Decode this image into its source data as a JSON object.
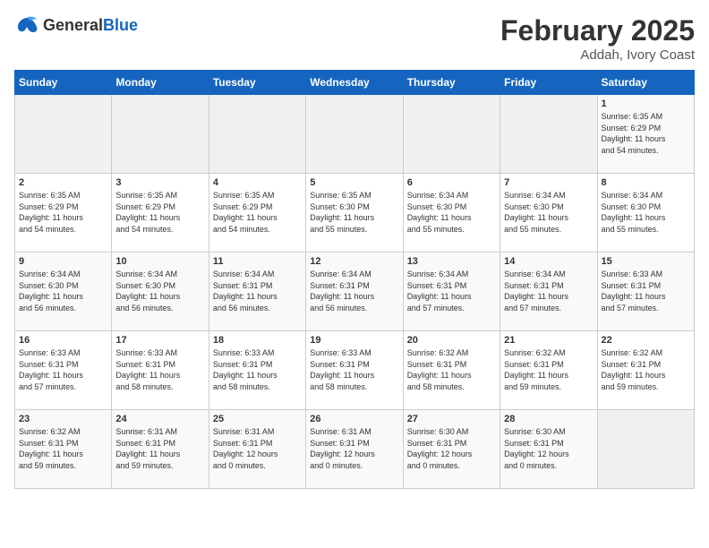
{
  "logo": {
    "general": "General",
    "blue": "Blue"
  },
  "title": "February 2025",
  "subtitle": "Addah, Ivory Coast",
  "weekdays": [
    "Sunday",
    "Monday",
    "Tuesday",
    "Wednesday",
    "Thursday",
    "Friday",
    "Saturday"
  ],
  "weeks": [
    [
      {
        "day": "",
        "info": ""
      },
      {
        "day": "",
        "info": ""
      },
      {
        "day": "",
        "info": ""
      },
      {
        "day": "",
        "info": ""
      },
      {
        "day": "",
        "info": ""
      },
      {
        "day": "",
        "info": ""
      },
      {
        "day": "1",
        "info": "Sunrise: 6:35 AM\nSunset: 6:29 PM\nDaylight: 11 hours\nand 54 minutes."
      }
    ],
    [
      {
        "day": "2",
        "info": "Sunrise: 6:35 AM\nSunset: 6:29 PM\nDaylight: 11 hours\nand 54 minutes."
      },
      {
        "day": "3",
        "info": "Sunrise: 6:35 AM\nSunset: 6:29 PM\nDaylight: 11 hours\nand 54 minutes."
      },
      {
        "day": "4",
        "info": "Sunrise: 6:35 AM\nSunset: 6:29 PM\nDaylight: 11 hours\nand 54 minutes."
      },
      {
        "day": "5",
        "info": "Sunrise: 6:35 AM\nSunset: 6:30 PM\nDaylight: 11 hours\nand 55 minutes."
      },
      {
        "day": "6",
        "info": "Sunrise: 6:34 AM\nSunset: 6:30 PM\nDaylight: 11 hours\nand 55 minutes."
      },
      {
        "day": "7",
        "info": "Sunrise: 6:34 AM\nSunset: 6:30 PM\nDaylight: 11 hours\nand 55 minutes."
      },
      {
        "day": "8",
        "info": "Sunrise: 6:34 AM\nSunset: 6:30 PM\nDaylight: 11 hours\nand 55 minutes."
      }
    ],
    [
      {
        "day": "9",
        "info": "Sunrise: 6:34 AM\nSunset: 6:30 PM\nDaylight: 11 hours\nand 56 minutes."
      },
      {
        "day": "10",
        "info": "Sunrise: 6:34 AM\nSunset: 6:30 PM\nDaylight: 11 hours\nand 56 minutes."
      },
      {
        "day": "11",
        "info": "Sunrise: 6:34 AM\nSunset: 6:31 PM\nDaylight: 11 hours\nand 56 minutes."
      },
      {
        "day": "12",
        "info": "Sunrise: 6:34 AM\nSunset: 6:31 PM\nDaylight: 11 hours\nand 56 minutes."
      },
      {
        "day": "13",
        "info": "Sunrise: 6:34 AM\nSunset: 6:31 PM\nDaylight: 11 hours\nand 57 minutes."
      },
      {
        "day": "14",
        "info": "Sunrise: 6:34 AM\nSunset: 6:31 PM\nDaylight: 11 hours\nand 57 minutes."
      },
      {
        "day": "15",
        "info": "Sunrise: 6:33 AM\nSunset: 6:31 PM\nDaylight: 11 hours\nand 57 minutes."
      }
    ],
    [
      {
        "day": "16",
        "info": "Sunrise: 6:33 AM\nSunset: 6:31 PM\nDaylight: 11 hours\nand 57 minutes."
      },
      {
        "day": "17",
        "info": "Sunrise: 6:33 AM\nSunset: 6:31 PM\nDaylight: 11 hours\nand 58 minutes."
      },
      {
        "day": "18",
        "info": "Sunrise: 6:33 AM\nSunset: 6:31 PM\nDaylight: 11 hours\nand 58 minutes."
      },
      {
        "day": "19",
        "info": "Sunrise: 6:33 AM\nSunset: 6:31 PM\nDaylight: 11 hours\nand 58 minutes."
      },
      {
        "day": "20",
        "info": "Sunrise: 6:32 AM\nSunset: 6:31 PM\nDaylight: 11 hours\nand 58 minutes."
      },
      {
        "day": "21",
        "info": "Sunrise: 6:32 AM\nSunset: 6:31 PM\nDaylight: 11 hours\nand 59 minutes."
      },
      {
        "day": "22",
        "info": "Sunrise: 6:32 AM\nSunset: 6:31 PM\nDaylight: 11 hours\nand 59 minutes."
      }
    ],
    [
      {
        "day": "23",
        "info": "Sunrise: 6:32 AM\nSunset: 6:31 PM\nDaylight: 11 hours\nand 59 minutes."
      },
      {
        "day": "24",
        "info": "Sunrise: 6:31 AM\nSunset: 6:31 PM\nDaylight: 11 hours\nand 59 minutes."
      },
      {
        "day": "25",
        "info": "Sunrise: 6:31 AM\nSunset: 6:31 PM\nDaylight: 12 hours\nand 0 minutes."
      },
      {
        "day": "26",
        "info": "Sunrise: 6:31 AM\nSunset: 6:31 PM\nDaylight: 12 hours\nand 0 minutes."
      },
      {
        "day": "27",
        "info": "Sunrise: 6:30 AM\nSunset: 6:31 PM\nDaylight: 12 hours\nand 0 minutes."
      },
      {
        "day": "28",
        "info": "Sunrise: 6:30 AM\nSunset: 6:31 PM\nDaylight: 12 hours\nand 0 minutes."
      },
      {
        "day": "",
        "info": ""
      }
    ]
  ]
}
